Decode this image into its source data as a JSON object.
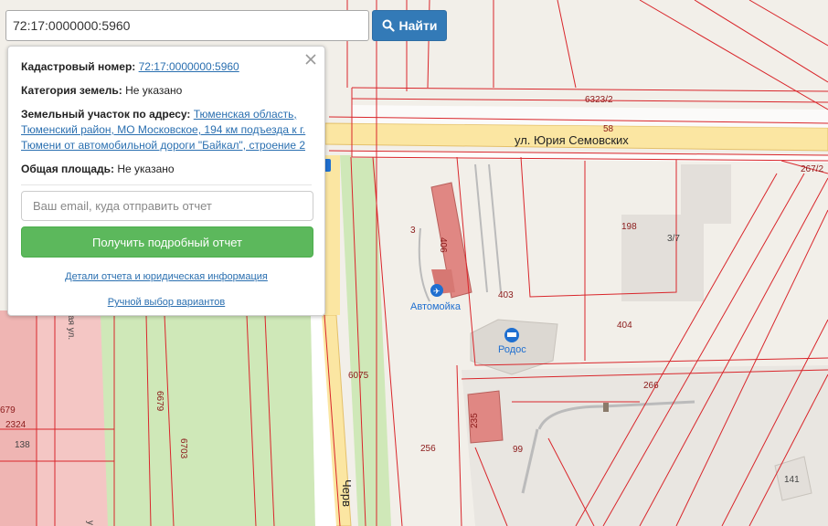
{
  "search": {
    "value": "72:17:0000000:5960",
    "button_label": "Найти",
    "button_icon": "search-icon"
  },
  "popup": {
    "cadastral_label": "Кадастровый номер:",
    "cadastral_value": "72:17:0000000:5960",
    "category_label": "Категория земель:",
    "category_value": "Не указано",
    "address_label": "Земельный участок по адресу:",
    "address_value": "Тюменская область, Тюменский район, МО Московское, 194 км подъезда к г. Тюмени от автомобильной дороги \"Байкал\", строение 2",
    "area_label": "Общая площадь:",
    "area_value": "Не указано",
    "email_placeholder": "Ваш email, куда отправить отчет",
    "report_button": "Получить подробный отчет",
    "details_link": "Детали отчета и юридическая информация",
    "manual_link": "Ручной выбор вариантов",
    "close_icon": "close-icon"
  },
  "map": {
    "street_name": "ул. Юрия Семовских",
    "side_street": "Черв",
    "side_street_2": "ая ул.",
    "side_street_3": "у",
    "poi_carwash": "Автомойка",
    "poi_hotel": "Родос",
    "parcel_labels": [
      "6323/2",
      "58",
      "267/2",
      "198",
      "3/7",
      "3",
      "406",
      "403",
      "404",
      "6075",
      "6679",
      "6703",
      "266",
      "235",
      "256",
      "99",
      "141",
      "2324",
      "679",
      "138"
    ],
    "colors": {
      "parcel_line": "#d9262b",
      "road_yellow": "#fbe6a2",
      "green": "#cfe8b8",
      "pink": "#f4c6c4",
      "building_pink": "#e08783",
      "building_grey": "#dcd8d2",
      "search_button": "#337ab7",
      "report_button": "#5cb85c",
      "link": "#2a6fb0"
    }
  }
}
